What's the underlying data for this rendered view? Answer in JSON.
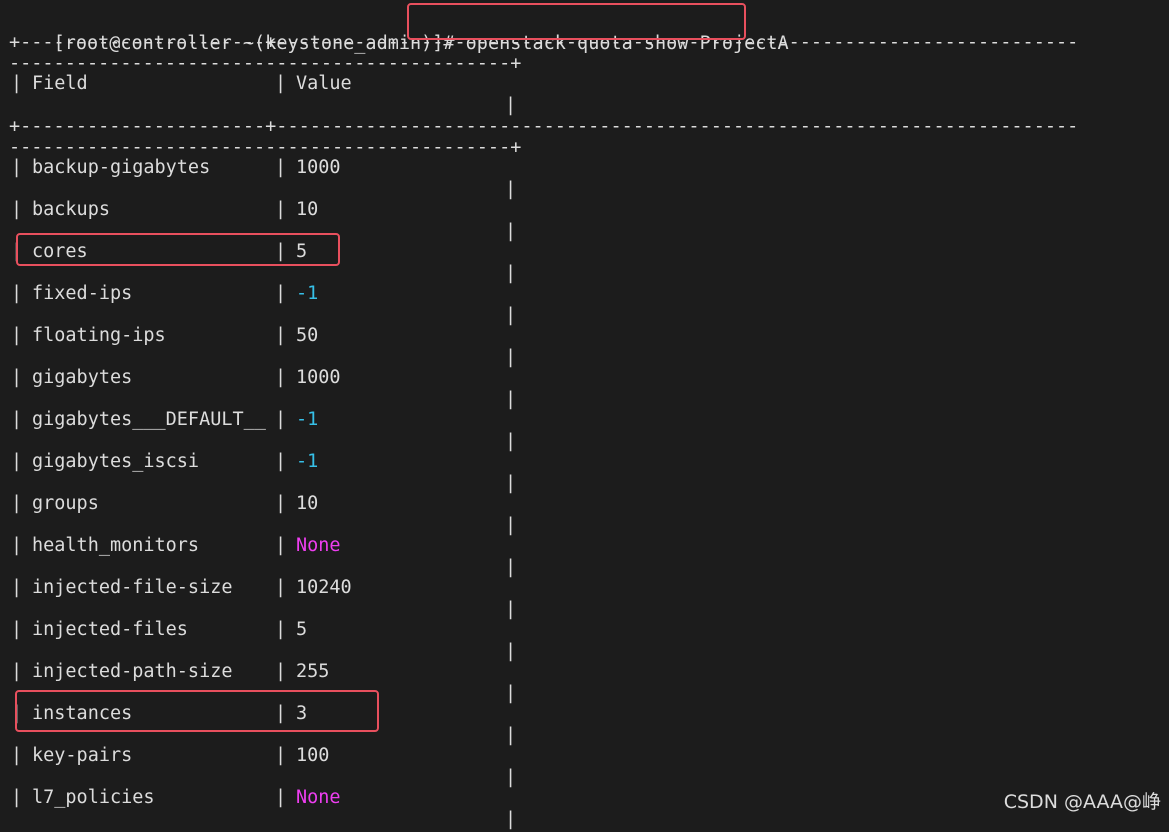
{
  "terminal": {
    "prompt": "[root@controller ~(keystone_admin)]#",
    "command": "openstack quota show ProjectA",
    "border_top_a": "+----------------------+------------------------------------------------------------------------",
    "border_top_b": "---------------------------------------------+",
    "border_mid_a": "+----------------------+------------------------------------------------------------------------",
    "border_mid_b": "---------------------------------------------+",
    "header": {
      "field": "Field",
      "value": "Value"
    },
    "pipe": "|",
    "rows": [
      {
        "field": "backup-gigabytes",
        "value": "1000",
        "kind": "num"
      },
      {
        "field": "backups",
        "value": "10",
        "kind": "num"
      },
      {
        "field": "cores",
        "value": "5",
        "kind": "num",
        "highlighted": true
      },
      {
        "field": "fixed-ips",
        "value": "-1",
        "kind": "neg"
      },
      {
        "field": "floating-ips",
        "value": "50",
        "kind": "num"
      },
      {
        "field": "gigabytes",
        "value": "1000",
        "kind": "num"
      },
      {
        "field": "gigabytes___DEFAULT__",
        "value": "-1",
        "kind": "neg"
      },
      {
        "field": "gigabytes_iscsi",
        "value": "-1",
        "kind": "neg"
      },
      {
        "field": "groups",
        "value": "10",
        "kind": "num"
      },
      {
        "field": "health_monitors",
        "value": "None",
        "kind": "none"
      },
      {
        "field": "injected-file-size",
        "value": "10240",
        "kind": "num"
      },
      {
        "field": "injected-files",
        "value": "5",
        "kind": "num"
      },
      {
        "field": "injected-path-size",
        "value": "255",
        "kind": "num"
      },
      {
        "field": "instances",
        "value": "3",
        "kind": "num",
        "highlighted": true
      },
      {
        "field": "key-pairs",
        "value": "100",
        "kind": "num"
      },
      {
        "field": "l7_policies",
        "value": "None",
        "kind": "none"
      }
    ],
    "colors": {
      "background": "#1c1c1c",
      "text": "#dcdcdc",
      "negative": "#36c0e8",
      "none": "#ee3ef0",
      "highlight": "#e8505e"
    }
  },
  "watermark": "CSDN @AAA@峥"
}
